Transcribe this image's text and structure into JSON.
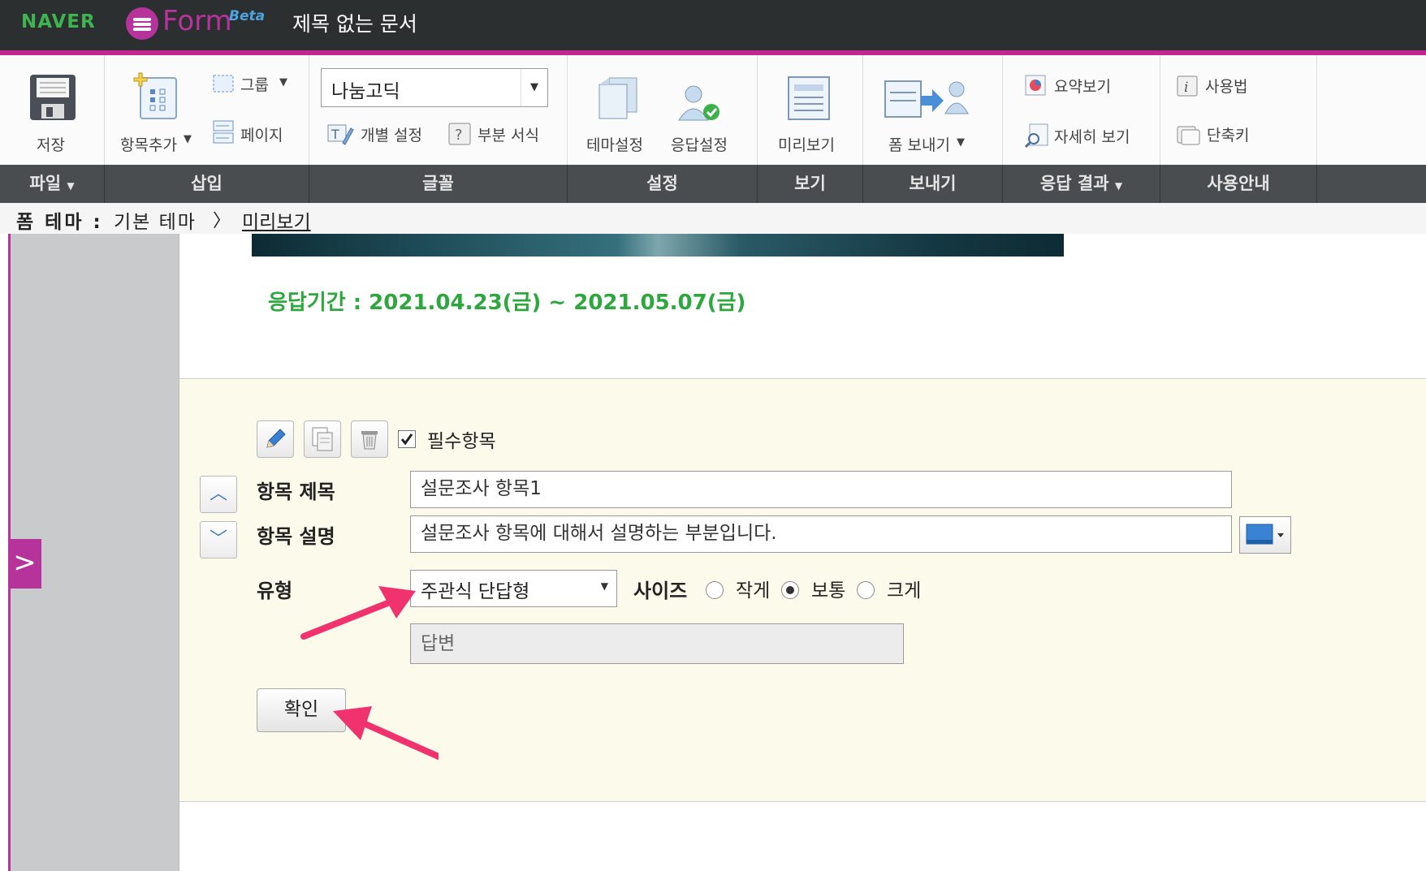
{
  "header": {
    "naver": "NAVER",
    "form_word": "Form",
    "beta": "Beta",
    "doc_title": "제목 없는 문서"
  },
  "toolbar": {
    "save": "저장",
    "add_item": "항목추가",
    "group": "그룹",
    "page": "페이지",
    "font_value": "나눔고딕",
    "individual_setting": "개별 설정",
    "partial_format": "부분 서식",
    "theme_setting": "테마설정",
    "response_setting": "응답설정",
    "preview": "미리보기",
    "send_form": "폼 보내기",
    "summary_view": "요약보기",
    "detail_view": "자세히 보기",
    "usage": "사용법",
    "shortcut": "단축키"
  },
  "groups": {
    "file": "파일",
    "insert": "삽입",
    "font": "글꼴",
    "setting": "설정",
    "view": "보기",
    "send": "보내기",
    "result": "응답 결과",
    "guide": "사용안내"
  },
  "breadcrumb": {
    "label": "폼 테마 :",
    "theme": "기본 테마",
    "separator": "〉",
    "preview_link": "미리보기"
  },
  "form": {
    "response_period": "응답기간 : 2021.04.23(금) ~ 2021.05.07(금)"
  },
  "question": {
    "required_label": "필수항목",
    "required_checked": true,
    "title_label": "항목 제목",
    "title_value": "설문조사 항목1",
    "desc_label": "항목 설명",
    "desc_value": "설문조사 항목에 대해서 설명하는 부분입니다.",
    "type_label": "유형",
    "type_value": "주관식 단답형",
    "size_label": "사이즈",
    "size_options": [
      "작게",
      "보통",
      "크게"
    ],
    "size_selected": "보통",
    "answer_placeholder": "답변",
    "confirm_button": "확인"
  },
  "colors": {
    "accent": "#c4288f",
    "naver_green": "#3fb34f",
    "period_green": "#2ea83e",
    "annotation_arrow": "#f0336f"
  }
}
